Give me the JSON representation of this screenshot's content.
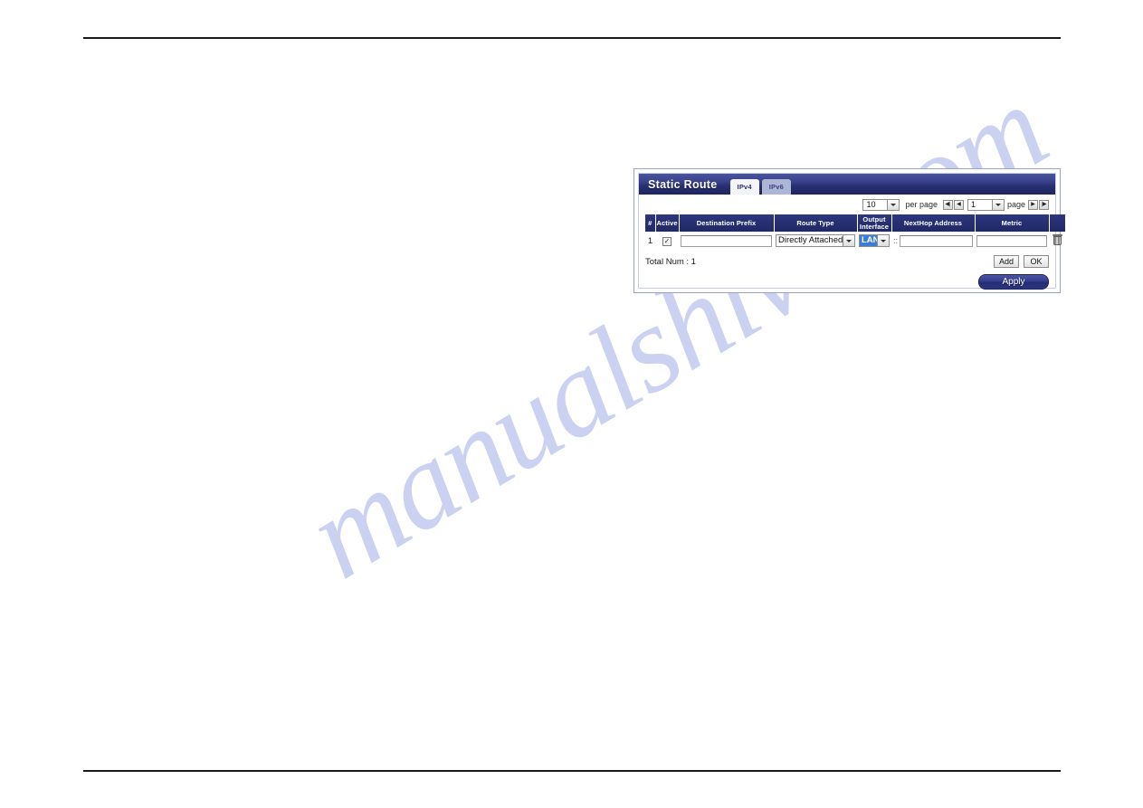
{
  "watermark": {
    "text": "manualshive.com"
  },
  "panel": {
    "title": "Static Route",
    "tabs": [
      {
        "label": "IPv4",
        "active": true
      },
      {
        "label": "IPv6",
        "active": false
      }
    ],
    "pager": {
      "per_page_value": "10",
      "per_page_label": "per page",
      "page_value": "1",
      "page_label": "page",
      "first_icon": "first-page-icon",
      "prev_icon": "previous-page-icon",
      "next_icon": "next-page-icon",
      "last_icon": "last-page-icon",
      "first_glyph": "◀|",
      "prev_glyph": "◀",
      "next_glyph": "▶",
      "last_glyph": "|▶"
    },
    "table": {
      "headers": [
        "#",
        "Active",
        "Destination Prefix",
        "Route Type",
        "Output Interface",
        "NextHop Address",
        "Metric",
        ""
      ],
      "rows": [
        {
          "index": "1",
          "active_checked": true,
          "check_glyph": "✓",
          "destination_prefix": "",
          "route_type": "Directly Attached",
          "output_interface": "LAN",
          "nexthop_prefix": "::",
          "nexthop_address": "",
          "metric": "",
          "delete_icon": "trash-icon"
        }
      ]
    },
    "total_text": "Total Num : 1",
    "buttons": {
      "add": "Add",
      "ok": "OK",
      "apply": "Apply"
    },
    "colors": {
      "header_blue": "#272f72",
      "titlebar_blue": "#1d2560",
      "select_highlight": "#3a7fd5",
      "watermark": "#c3cbef"
    }
  }
}
